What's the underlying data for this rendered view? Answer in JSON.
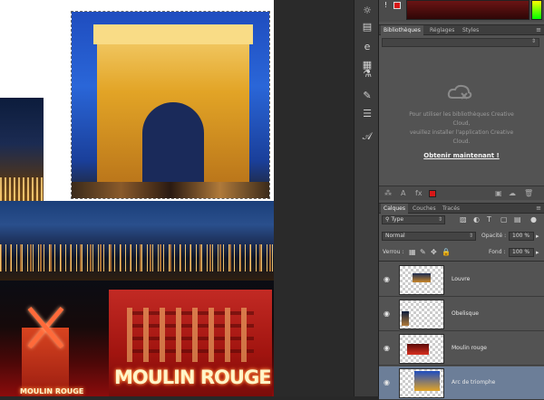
{
  "canvas": {
    "neon_sign": "MOULIN ROUGE",
    "neon_small": "MOULIN ROUGE"
  },
  "tools": [
    "sun-icon",
    "layers-mini-icon",
    "text-mini-icon",
    "properties-icon",
    "puzzle-icon",
    "brush-icon",
    "sliders-icon",
    "type-icon"
  ],
  "color": {
    "foreground": "#d81818",
    "warning": "!"
  },
  "libraries_panel": {
    "tabs": [
      "Bibliothèques",
      "Réglages",
      "Styles"
    ],
    "message_lines": [
      "Pour utiliser les bibliothèques Creative",
      "Cloud,",
      "veuillez installer l'application Creative",
      "Cloud."
    ],
    "cta": "Obtenir maintenant !"
  },
  "layers_panel": {
    "tabs": [
      "Calques",
      "Couches",
      "Tracés"
    ],
    "filter_label": "Type",
    "blend_mode": "Normal",
    "opacity_label": "Opacité :",
    "opacity_value": "100 %",
    "lock_label": "Verrou :",
    "fill_label": "Fond :",
    "fill_value": "100 %",
    "layers": [
      {
        "name": "Louvre",
        "selected": false
      },
      {
        "name": "Obelisque",
        "selected": false
      },
      {
        "name": "Moulin rouge",
        "selected": false
      },
      {
        "name": "Arc de triomphe",
        "selected": true
      }
    ]
  }
}
